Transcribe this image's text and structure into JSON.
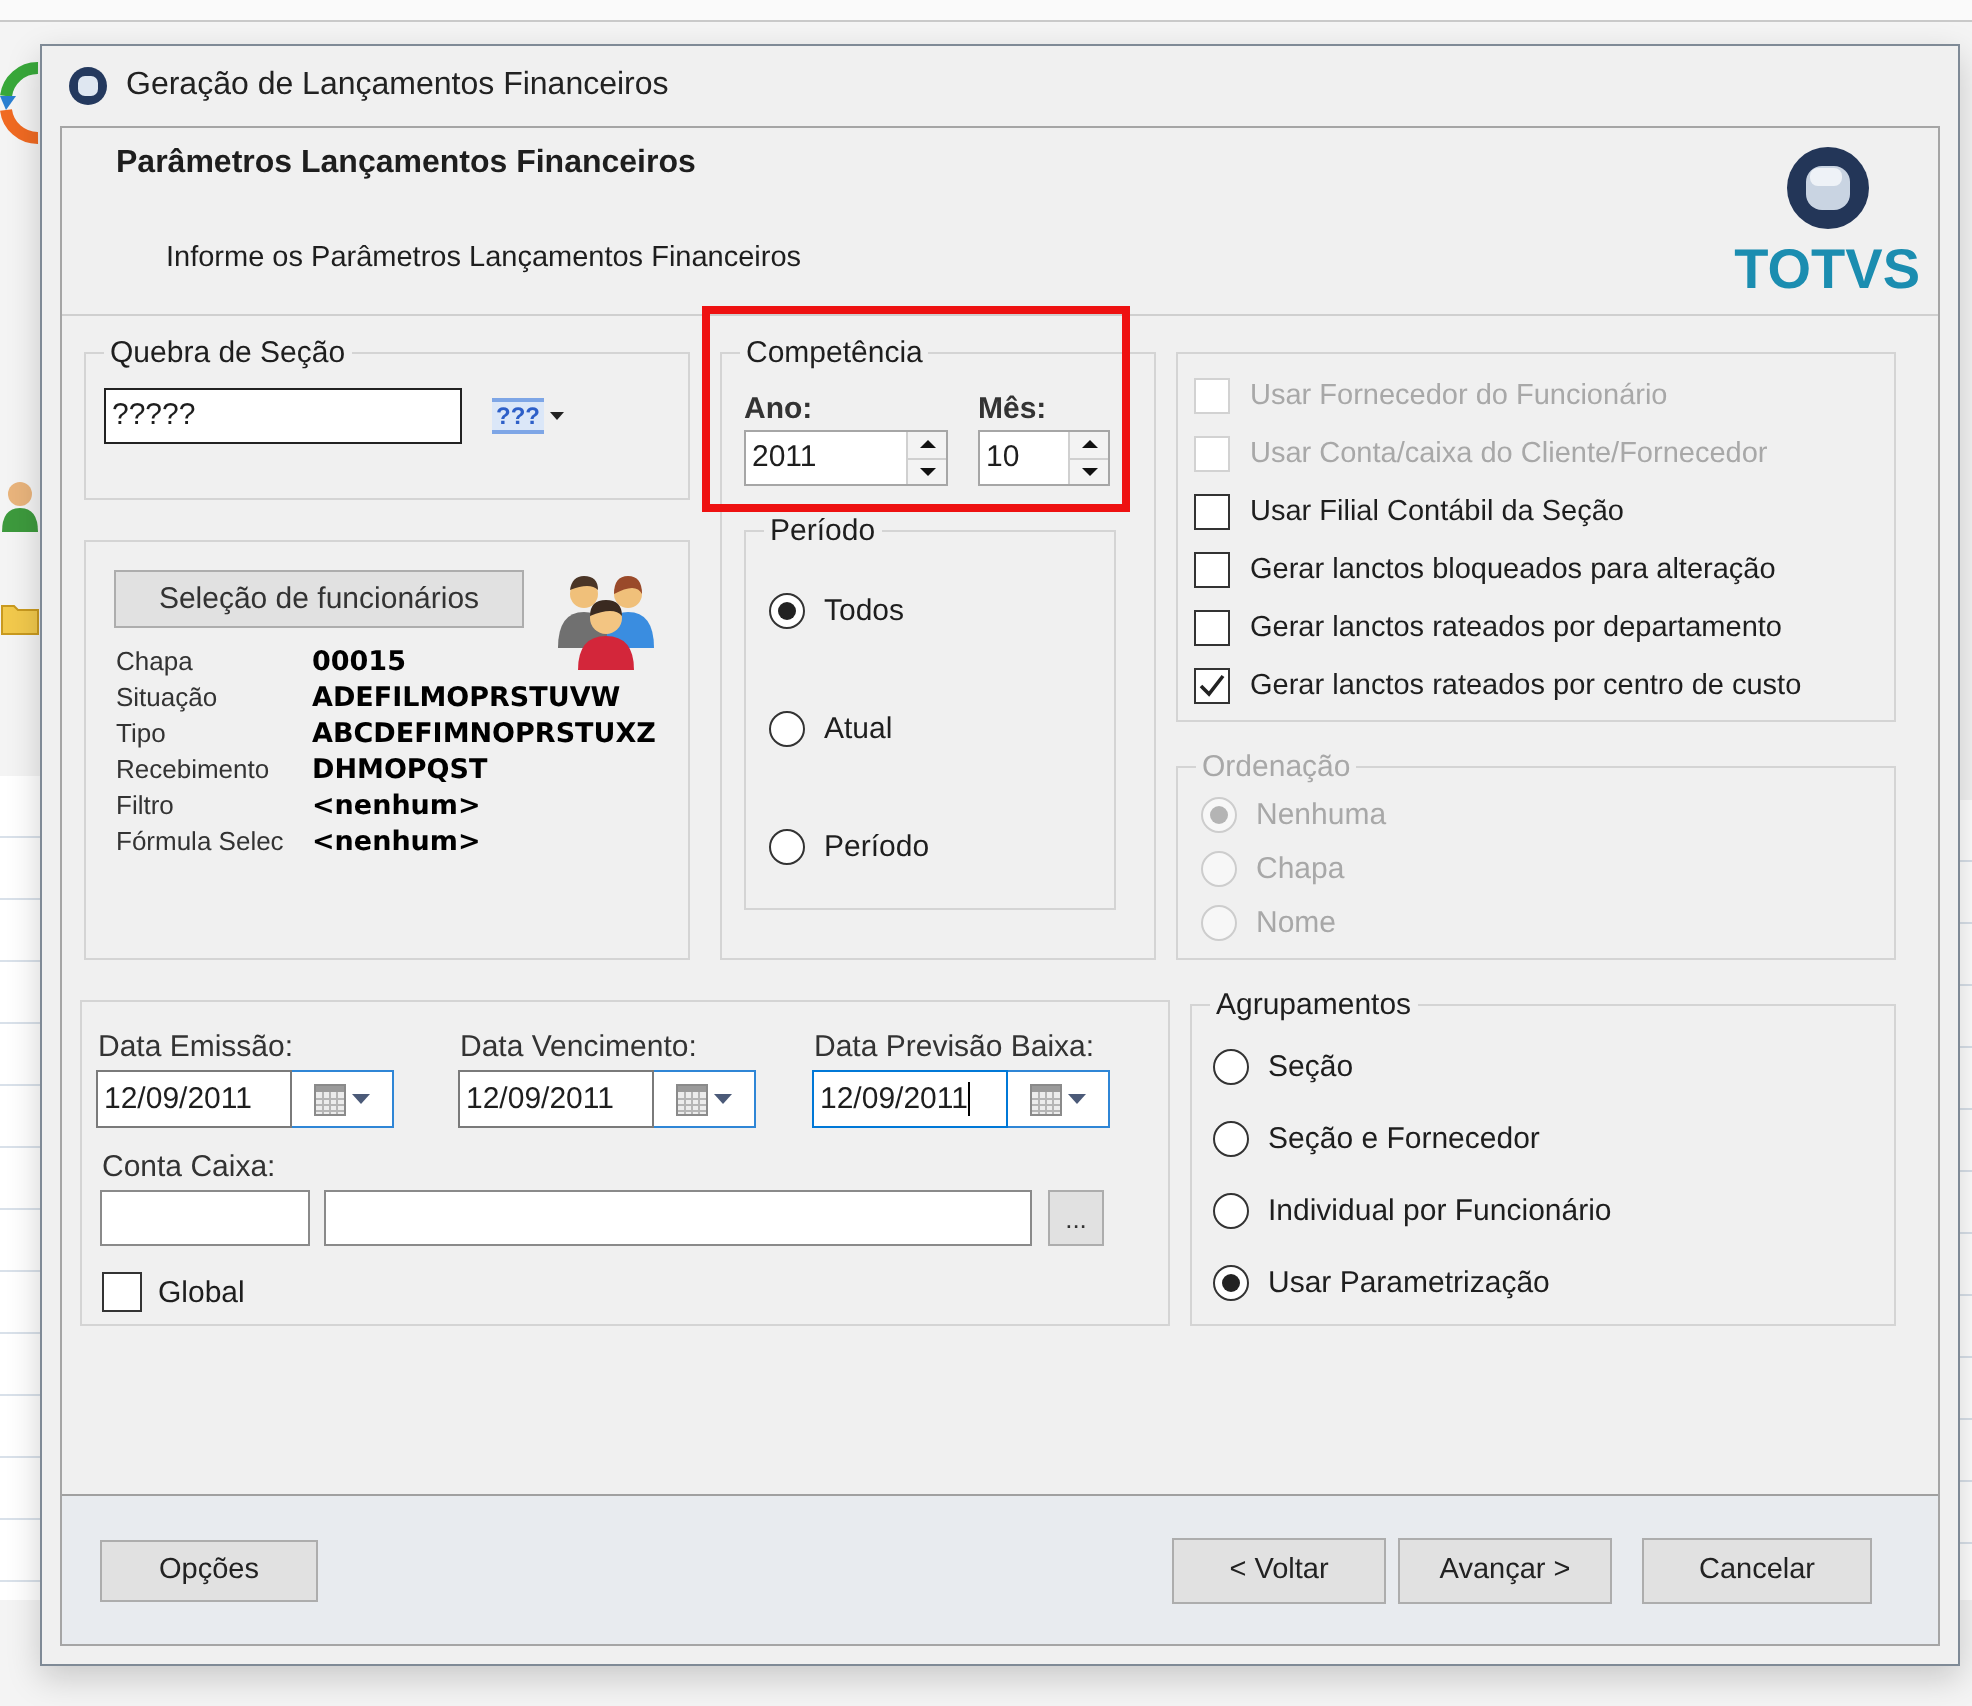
{
  "window": {
    "title": "Geração de Lançamentos Financeiros"
  },
  "header": {
    "title": "Parâmetros Lançamentos Financeiros",
    "subtitle": "Informe os Parâmetros Lançamentos Financeiros",
    "logo_text": "TOTVS"
  },
  "section_break": {
    "legend": "Quebra de Seção",
    "value": "?????",
    "picker_label": "???"
  },
  "employee_selection": {
    "button": "Seleção de funcionários",
    "rows": [
      {
        "label": "Chapa",
        "value": "00015"
      },
      {
        "label": "Situação",
        "value": "ADEFILMOPRSTUVW"
      },
      {
        "label": "Tipo",
        "value": "ABCDEFIMNOPRSTUXZ"
      },
      {
        "label": "Recebimento",
        "value": "DHMOPQST"
      },
      {
        "label": "Filtro",
        "value": "<nenhum>"
      },
      {
        "label": "Fórmula Selec",
        "value": "<nenhum>"
      }
    ]
  },
  "competence": {
    "legend": "Competência",
    "highlighted": true,
    "fields": [
      {
        "label": "Ano:",
        "value": "2011"
      },
      {
        "label": "Mês:",
        "value": "10"
      }
    ]
  },
  "period": {
    "legend": "Período",
    "options": [
      {
        "label": "Todos",
        "selected": true
      },
      {
        "label": "Atual",
        "selected": false
      },
      {
        "label": "Período",
        "selected": false
      }
    ]
  },
  "options": [
    {
      "label": "Usar Fornecedor do Funcionário",
      "checked": false,
      "disabled": true
    },
    {
      "label": "Usar Conta/caixa do Cliente/Fornecedor",
      "checked": false,
      "disabled": true
    },
    {
      "label": "Usar Filial Contábil da Seção",
      "checked": false,
      "disabled": false
    },
    {
      "label": "Gerar lanctos bloqueados para alteração",
      "checked": false,
      "disabled": false
    },
    {
      "label": "Gerar lanctos rateados por departamento",
      "checked": false,
      "disabled": false
    },
    {
      "label": "Gerar lanctos rateados por centro de custo",
      "checked": true,
      "disabled": false
    }
  ],
  "ordering": {
    "legend": "Ordenação",
    "disabled": true,
    "options": [
      {
        "label": "Nenhuma",
        "selected": true
      },
      {
        "label": "Chapa",
        "selected": false
      },
      {
        "label": "Nome",
        "selected": false
      }
    ]
  },
  "dates": [
    {
      "label": "Data Emissão:",
      "value": "12/09/2011",
      "focused": false
    },
    {
      "label": "Data Vencimento:",
      "value": "12/09/2011",
      "focused": false
    },
    {
      "label": "Data Previsão Baixa:",
      "value": "12/09/2011",
      "focused": true
    }
  ],
  "cash_account": {
    "label": "Conta Caixa:",
    "browse_button": "..."
  },
  "global": {
    "label": "Global",
    "checked": false
  },
  "grouping": {
    "legend": "Agrupamentos",
    "options": [
      {
        "label": "Seção",
        "selected": false
      },
      {
        "label": "Seção e Fornecedor",
        "selected": false
      },
      {
        "label": "Individual por Funcionário",
        "selected": false
      },
      {
        "label": "Usar Parametrização",
        "selected": true
      }
    ]
  },
  "footer": {
    "left_buttons": [
      "Opções"
    ],
    "right_buttons": [
      "< Voltar",
      "Avançar >",
      "Cancelar"
    ]
  }
}
